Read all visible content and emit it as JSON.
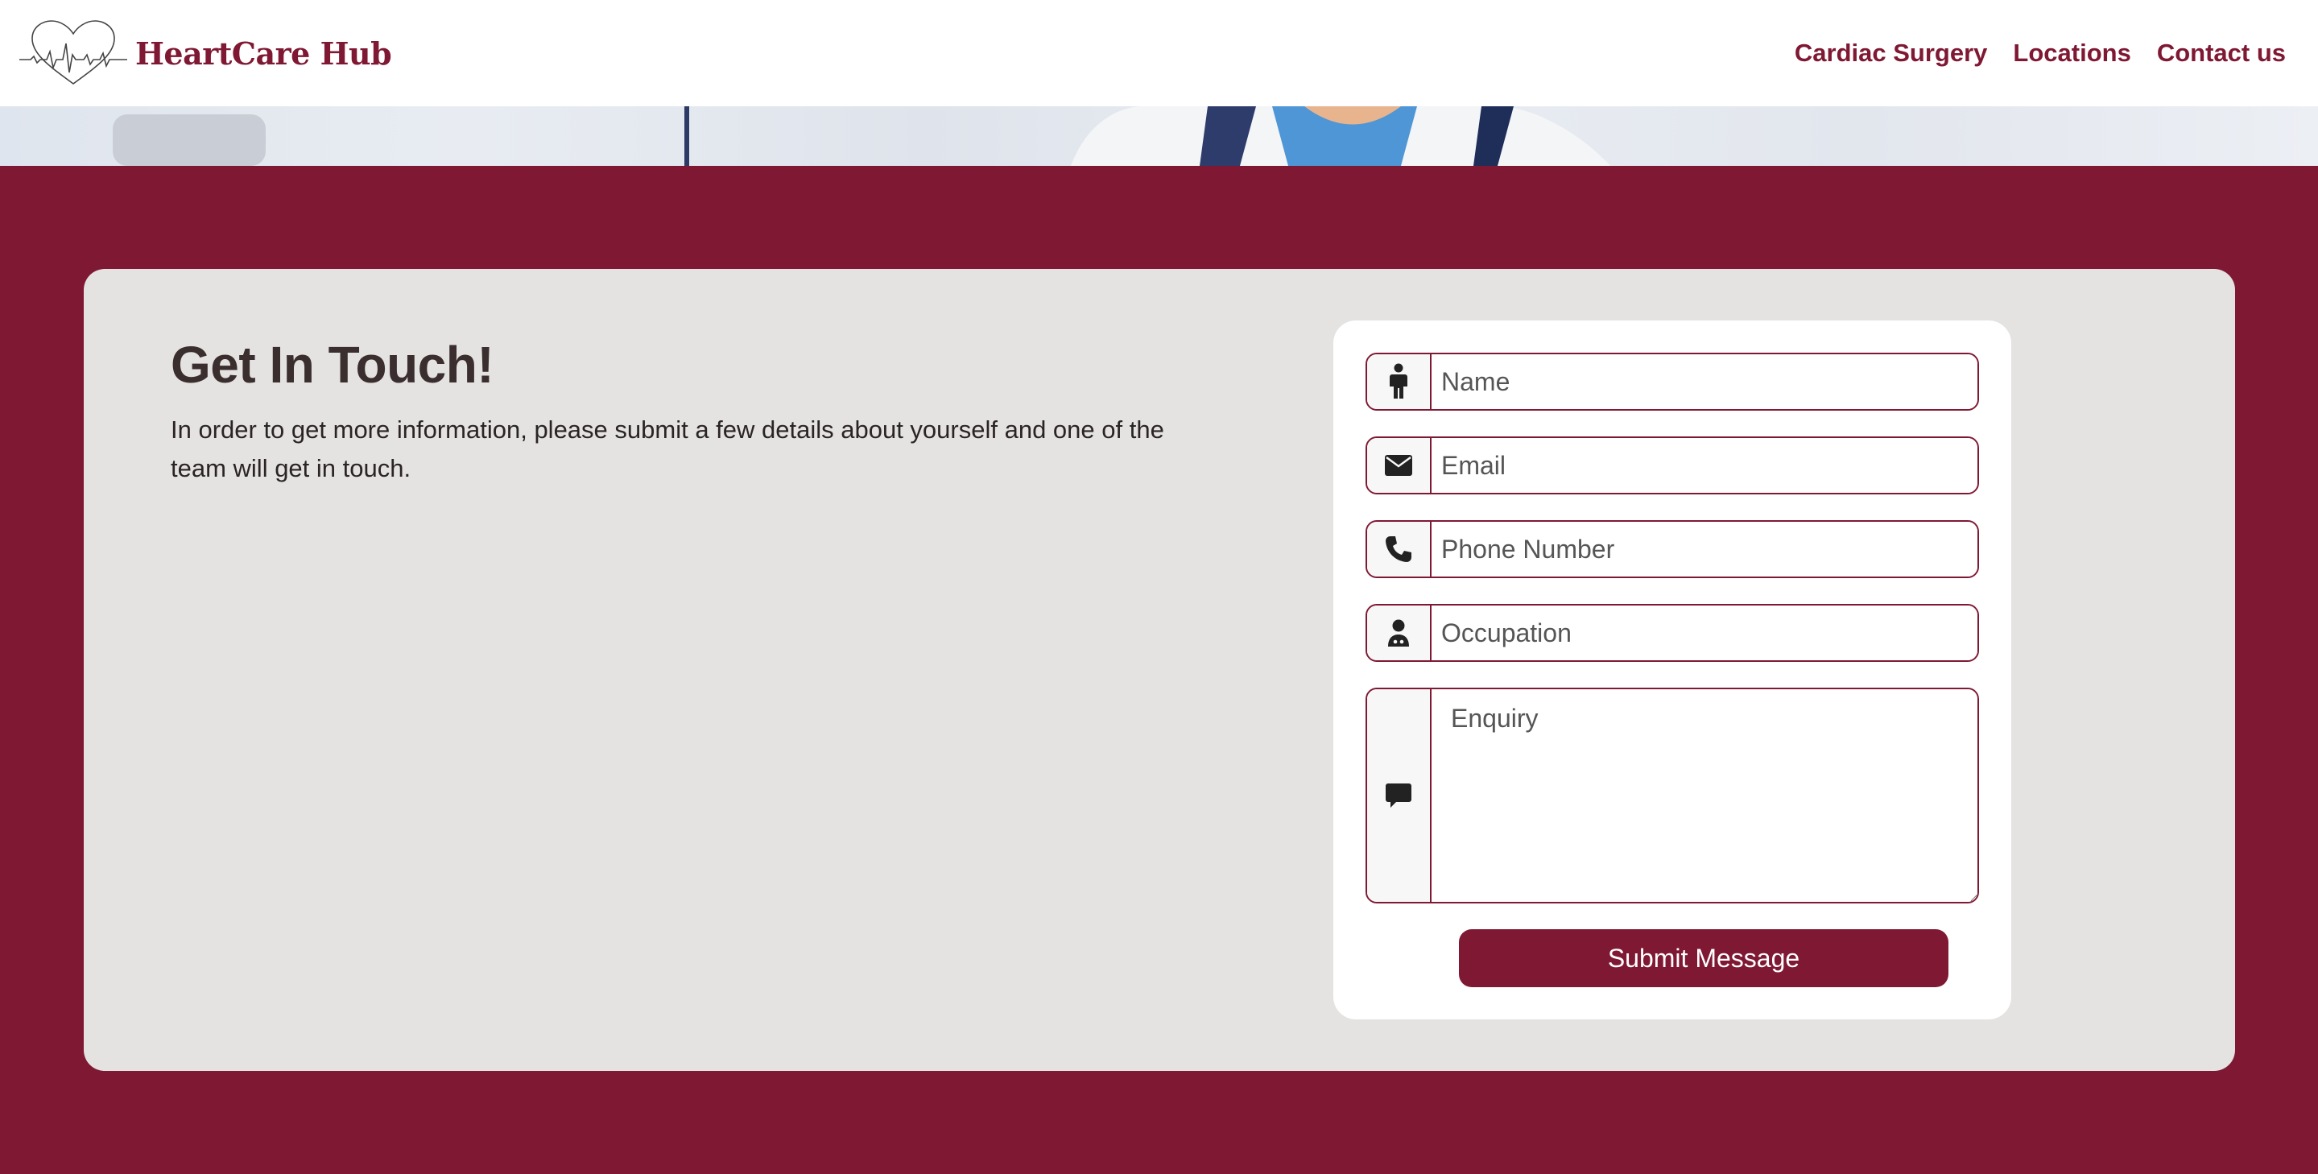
{
  "brand": {
    "name": "HeartCare Hub",
    "color": "#7f1833"
  },
  "nav": {
    "items": [
      {
        "label": "Cardiac Surgery"
      },
      {
        "label": "Locations"
      },
      {
        "label": "Contact us"
      }
    ]
  },
  "contact": {
    "title": "Get In Touch!",
    "intro": "In order to get more information, please submit a few details about yourself and one of the team will get in touch."
  },
  "form": {
    "fields": [
      {
        "placeholder": "Name",
        "icon": "person-icon",
        "value": ""
      },
      {
        "placeholder": "Email",
        "icon": "envelope-icon",
        "value": ""
      },
      {
        "placeholder": "Phone Number",
        "icon": "phone-icon",
        "value": ""
      },
      {
        "placeholder": "Occupation",
        "icon": "user-doctor-icon",
        "value": ""
      }
    ],
    "enquiry": {
      "placeholder": "Enquiry",
      "icon": "comment-icon",
      "value": ""
    },
    "submit_label": "Submit Message"
  },
  "colors": {
    "accent": "#7f1833",
    "card_bg": "#e4e3e1",
    "panel_bg": "#ffffff"
  }
}
